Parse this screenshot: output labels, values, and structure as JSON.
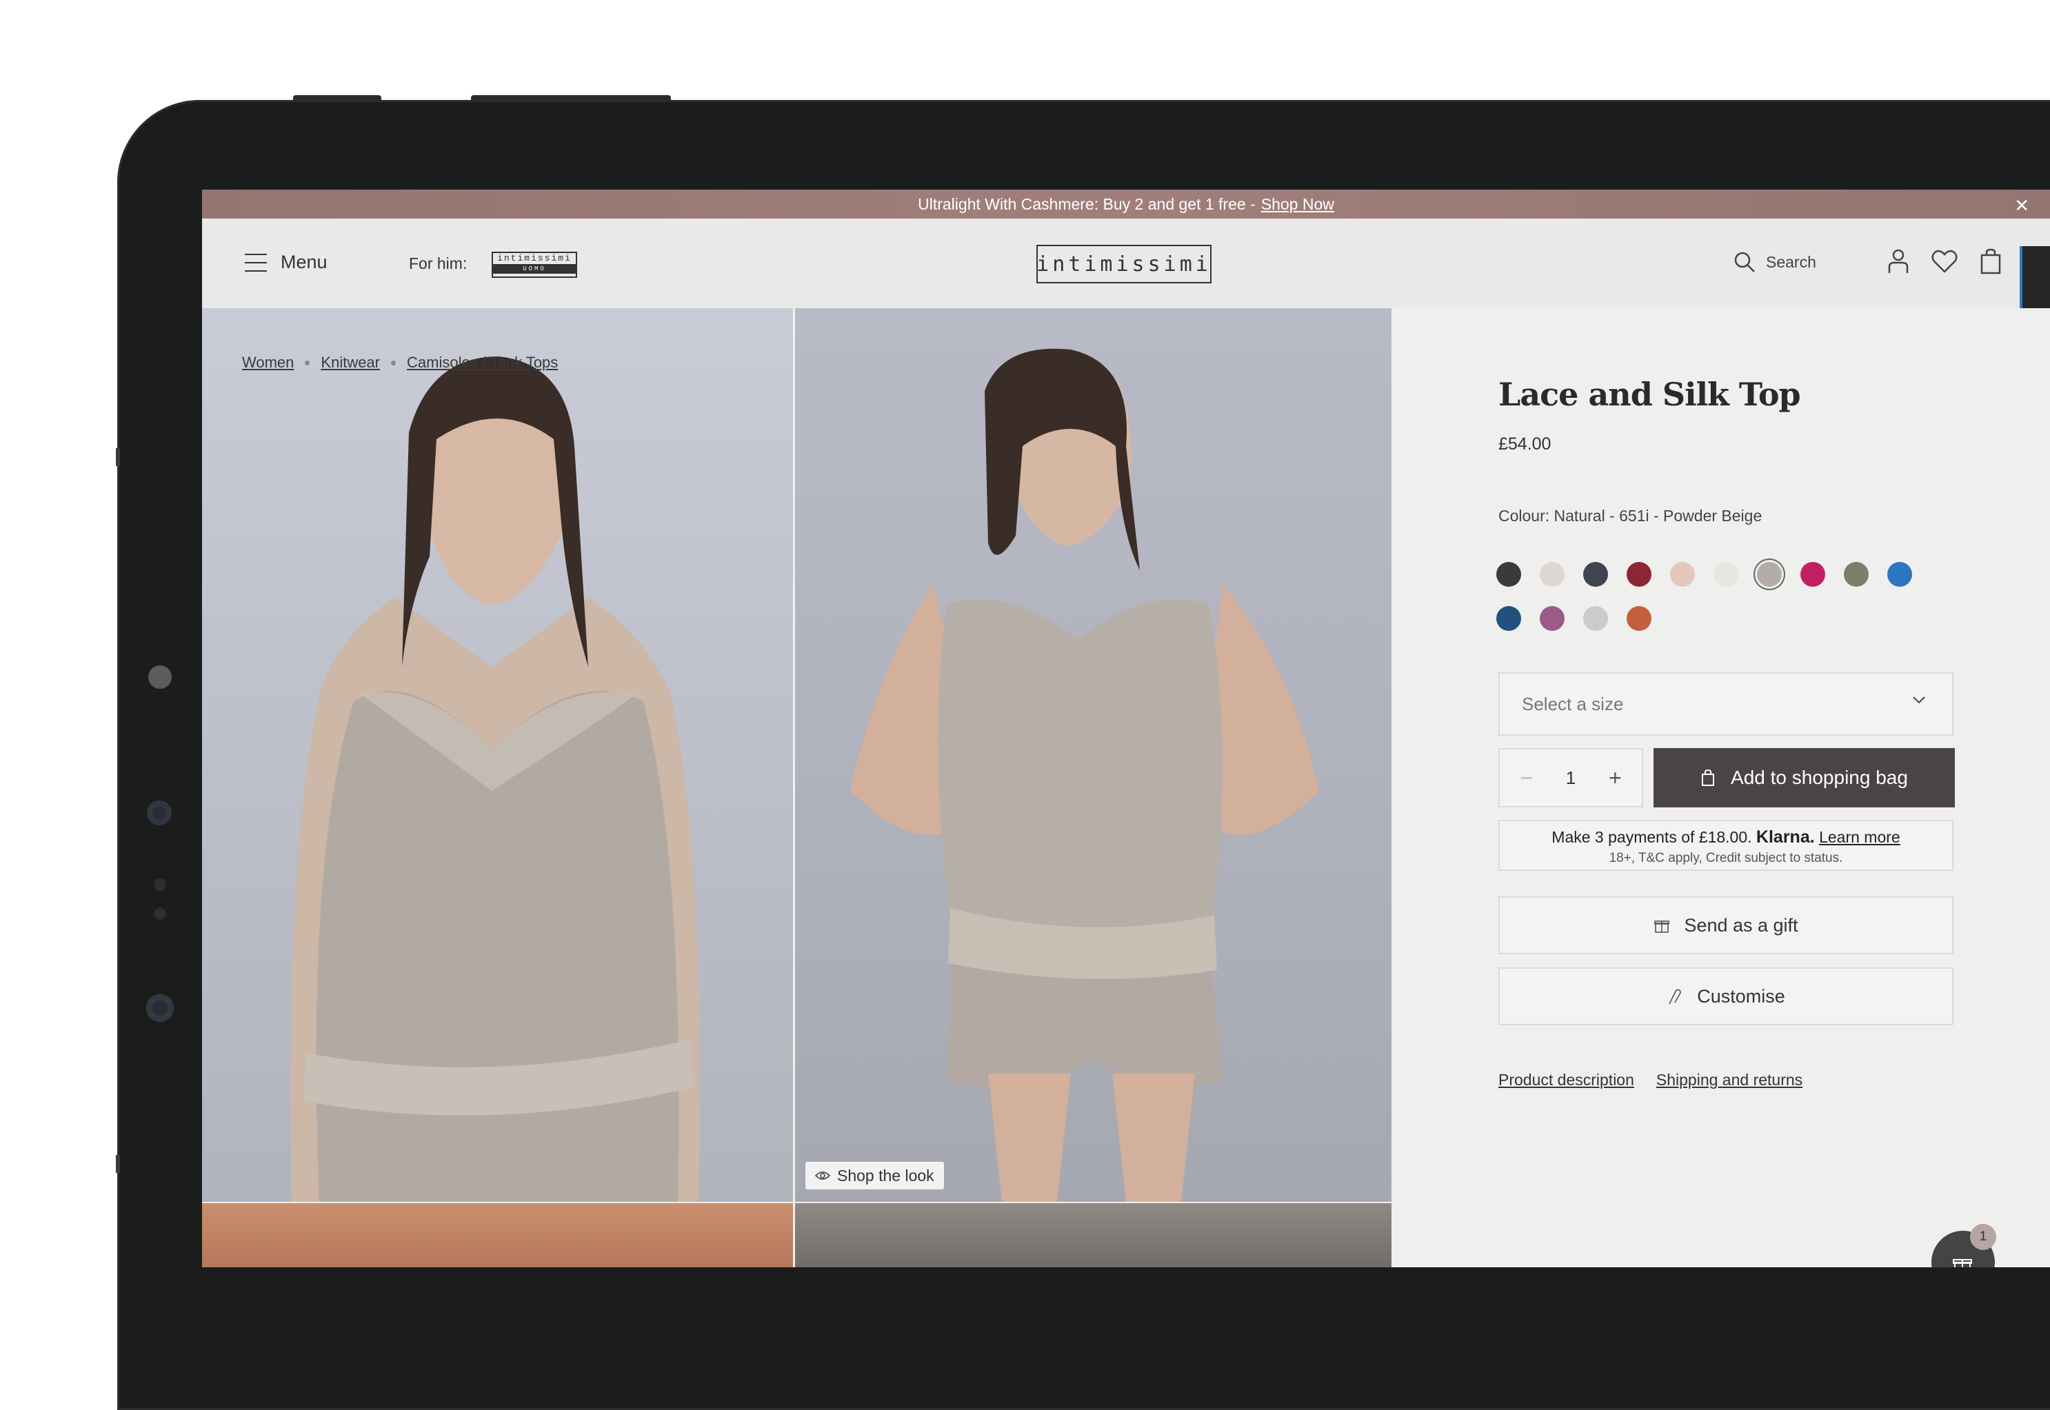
{
  "promo": {
    "text": "Ultralight With Cashmere: Buy 2 and get 1 free -",
    "link": "Shop Now",
    "close_icon": "close-icon"
  },
  "header": {
    "menu_label": "Menu",
    "for_him_label": "For him:",
    "uomo_logo_top": "intimissimi",
    "uomo_logo_bottom": "UOMO",
    "logo": "intimissimi",
    "search_label": "Search",
    "icons": [
      "menu-icon",
      "search-icon",
      "user-icon",
      "heart-icon",
      "shopping-bag-icon"
    ]
  },
  "breadcrumb": [
    "Women",
    "Knitwear",
    "Camisoles / Tank Tops"
  ],
  "gallery": {
    "shop_the_look": "Shop the look"
  },
  "product": {
    "title": "Lace and Silk Top",
    "price": "£54.00",
    "colour_label": "Colour: Natural - 651i - Powder Beige",
    "swatches": [
      {
        "color": "#3a3a3b",
        "selected": false
      },
      {
        "color": "#ddd6d1",
        "selected": false
      },
      {
        "color": "#3f4550",
        "selected": false
      },
      {
        "color": "#8e2532",
        "selected": false
      },
      {
        "color": "#e3c8bb",
        "selected": false
      },
      {
        "color": "#e8e6e0",
        "selected": false
      },
      {
        "color": "#b3aca7",
        "selected": true
      },
      {
        "color": "#c21f62",
        "selected": false
      },
      {
        "color": "#7d7f6c",
        "selected": false
      },
      {
        "color": "#2d75be",
        "selected": false
      },
      {
        "color": "#23507f",
        "selected": false
      },
      {
        "color": "#9c5a86",
        "selected": false
      },
      {
        "color": "#c9cbcd",
        "selected": false
      },
      {
        "color": "#c25f3c",
        "selected": false
      }
    ],
    "size_placeholder": "Select a size",
    "quantity": "1",
    "add_to_bag": "Add to shopping bag",
    "klarna_text": "Make 3 payments of £18.00.",
    "klarna_brand": "Klarna.",
    "klarna_link": "Learn more",
    "klarna_note": "18+, T&C apply, Credit subject to status.",
    "gift_label": "Send as a gift",
    "customise_label": "Customise",
    "links": [
      "Product description",
      "Shipping and returns"
    ]
  },
  "chat": {
    "badge": "1"
  }
}
